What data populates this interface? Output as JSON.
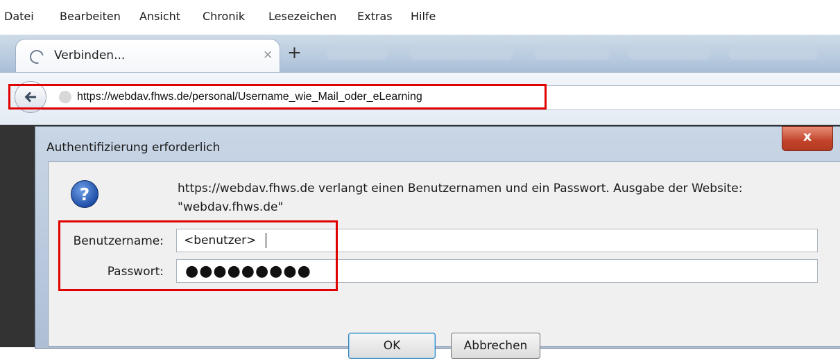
{
  "menu": {
    "items": [
      {
        "label": "Datei"
      },
      {
        "label": "Bearbeiten"
      },
      {
        "label": "Ansicht"
      },
      {
        "label": "Chronik"
      },
      {
        "label": "Lesezeichen"
      },
      {
        "label": "Extras"
      },
      {
        "label": "Hilfe"
      }
    ]
  },
  "tab": {
    "title": "Verbinden...",
    "close_glyph": "×",
    "icon": "loading-spinner-icon"
  },
  "newtab_glyph": "+",
  "nav": {
    "back_icon": "back-arrow-icon",
    "url": "https://webdav.fhws.de/personal/Username_wie_Mail_oder_eLearning"
  },
  "dialog": {
    "title": "Authentifizierung erforderlich",
    "close_glyph": "x",
    "icon": "question-icon",
    "icon_glyph": "?",
    "message_line1": "https://webdav.fhws.de verlangt einen Benutzernamen und ein Passwort. Ausgabe der Website:",
    "message_line2": "\"webdav.fhws.de\"",
    "username_label": "Benutzername:",
    "username_value": "<benutzer>",
    "password_label": "Passwort:",
    "password_value": "●●●●●●●●●",
    "ok_label": "OK",
    "cancel_label": "Abbrechen"
  },
  "colors": {
    "highlight": "#e00000",
    "dialog_frame": "#b9cbe0",
    "close_button": "#c1442a"
  }
}
